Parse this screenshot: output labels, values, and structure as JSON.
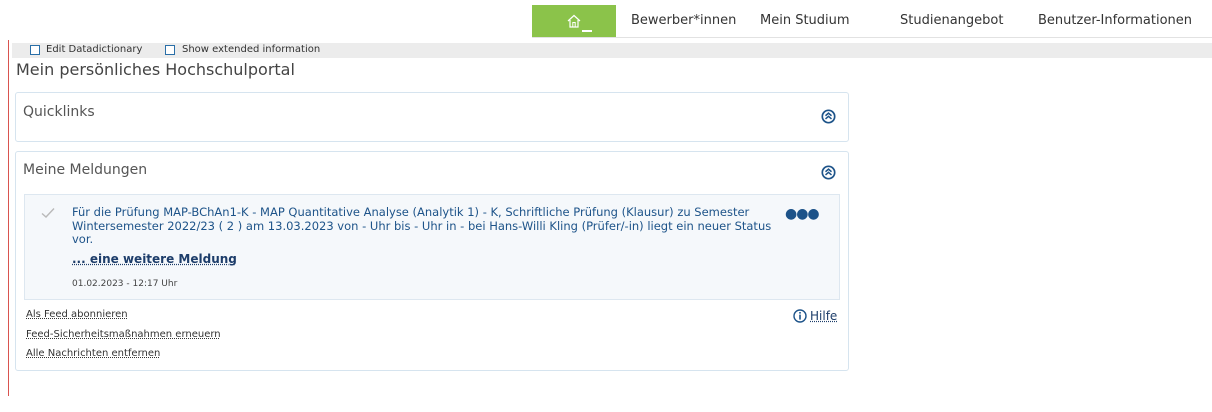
{
  "nav": {
    "items": [
      {
        "label": "Bewerber*innen"
      },
      {
        "label": "Mein Studium"
      },
      {
        "label": "Studienangebot"
      },
      {
        "label": "Benutzer-Informationen"
      }
    ],
    "home_icon": "home-icon",
    "accent_color": "#8bc34a"
  },
  "toolbar": {
    "edit_label": "Edit Datadictionary",
    "extended_label": "Show extended information"
  },
  "page": {
    "title": "Mein persönliches Hochschulportal"
  },
  "quicklinks": {
    "title": "Quicklinks"
  },
  "meldungen": {
    "title": "Meine Meldungen",
    "message": {
      "text": "Für die Prüfung MAP-BChAn1-K - MAP Quantitative Analyse (Analytik 1) - K, Schriftliche Prüfung (Klausur) zu Semester Wintersemester 2022/23 ( 2 ) am 13.03.2023 von - Uhr bis - Uhr in - bei Hans-Willi Kling (Prüfer/-in) liegt ein neuer Status vor.",
      "more_link": "... eine weitere Meldung",
      "timestamp": "01.02.2023 - 12:17 Uhr",
      "menu_icon": "more-dots-icon"
    },
    "links": [
      {
        "label": "Als Feed abonnieren"
      },
      {
        "label": "Feed-Sicherheitsmaßnahmen erneuern"
      },
      {
        "label": "Alle Nachrichten entfernen"
      }
    ],
    "help_label": "Hilfe"
  }
}
